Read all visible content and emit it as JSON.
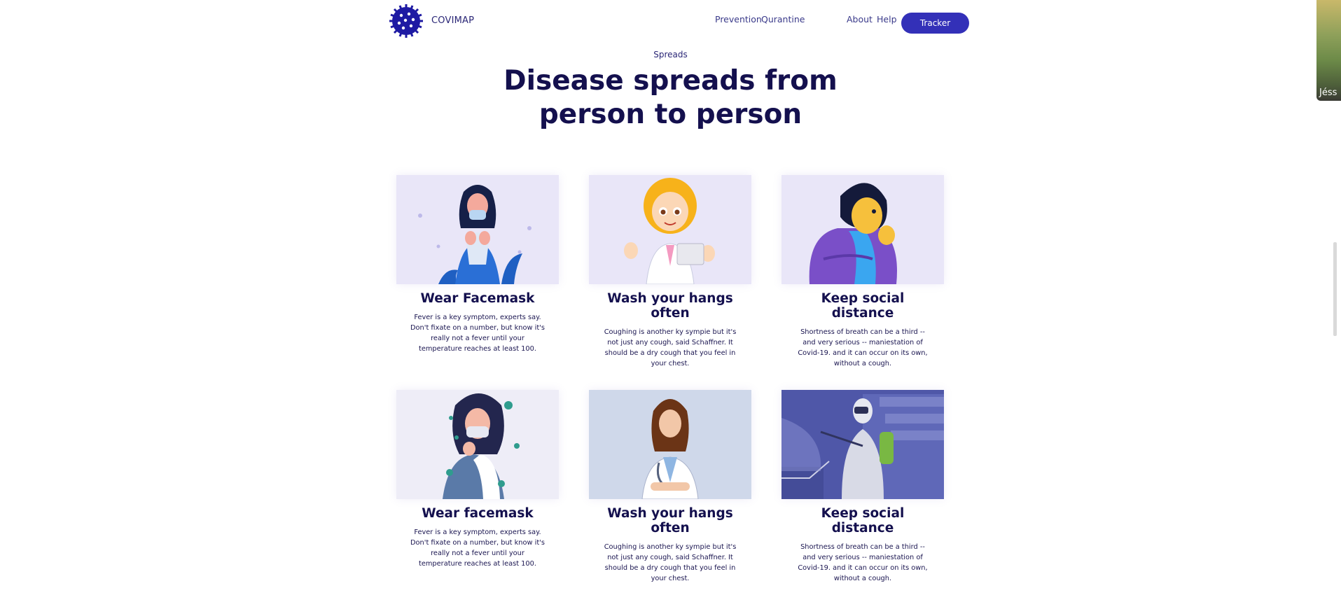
{
  "header": {
    "brand": "COVIMAP",
    "nav": [
      "Prevention",
      "Qurantine",
      "About",
      "Help"
    ],
    "tracker_label": "Tracker"
  },
  "section": {
    "eyebrow": "Spreads",
    "headline_line1": "Disease spreads from",
    "headline_line2": "person to person"
  },
  "cards": [
    {
      "title": "Wear Facemask",
      "text": "Fever is a key symptom, experts say. Don't fixate on a number, but know it's really not a fever until your temperature reaches at least 100."
    },
    {
      "title": "Wash your hangs often",
      "text": "Coughing is another ky sympie but it's not just any cough, said Schaffner. It should be a dry cough that you feel in your chest."
    },
    {
      "title": "Keep social distance",
      "text": "Shortness of breath can be a third -- and very serious -- maniestation of Covid-19. and it can occur on its own, without a cough."
    },
    {
      "title": "Wear facemask",
      "text": "Fever is a key symptom, experts say. Don't fixate on a number, but know it's really not a fever until your temperature reaches at least 100."
    },
    {
      "title": "Wash your hangs often",
      "text": "Coughing is another ky sympie but it's not just any cough, said Schaffner. It should be a dry cough that you feel in your chest."
    },
    {
      "title": "Keep social distance",
      "text": "Shortness of breath can be a third -- and very serious -- maniestation of Covid-19. and it can occur on its own, without a cough."
    }
  ],
  "side_thumbnail": {
    "label": "Jéss"
  },
  "colors": {
    "primary": "#3330b8",
    "heading": "#14104e",
    "logo": "#1e1aa3",
    "card_bg_lavender": "#e9e6f8",
    "card_bg_blue": "#cfd8ea",
    "card_bg_indigo": "#4f57a8"
  },
  "icons": [
    "virus-logo-icon"
  ]
}
